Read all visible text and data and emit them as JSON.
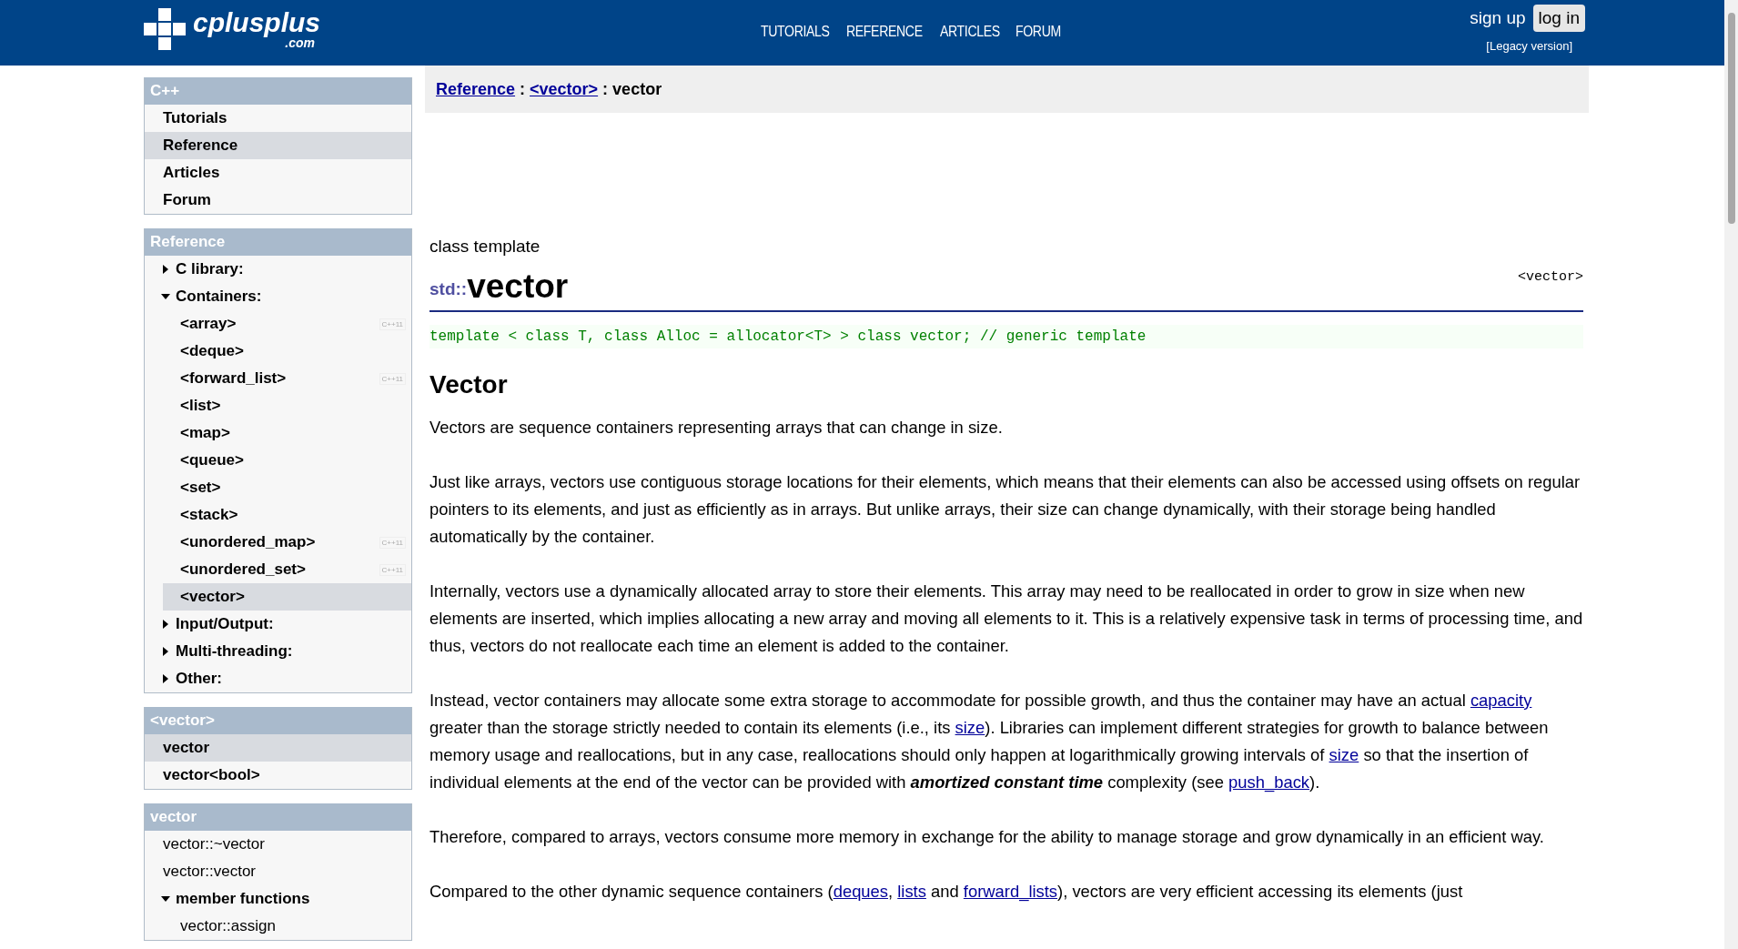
{
  "header": {
    "logo": {
      "name": "cplusplus",
      "suffix": ".com"
    },
    "nav": [
      "TUTORIALS",
      "REFERENCE",
      "ARTICLES",
      "FORUM"
    ],
    "sign_up": "sign up",
    "log_in": "log in",
    "legacy": "[Legacy version]"
  },
  "sidebar": [
    {
      "title": "C++",
      "items": [
        {
          "label": "Tutorials",
          "selected": false
        },
        {
          "label": "Reference",
          "selected": true
        },
        {
          "label": "Articles",
          "selected": false
        },
        {
          "label": "Forum",
          "selected": false
        }
      ]
    },
    {
      "title": "Reference",
      "items": [
        {
          "label": "C library:",
          "selected": false,
          "expanded": false
        },
        {
          "label": "Containers:",
          "selected": false,
          "expanded": true,
          "children": [
            {
              "label": "<array>",
              "selected": false,
              "tag": "C++11"
            },
            {
              "label": "<deque>",
              "selected": false
            },
            {
              "label": "<forward_list>",
              "selected": false,
              "tag": "C++11"
            },
            {
              "label": "<list>",
              "selected": false
            },
            {
              "label": "<map>",
              "selected": false
            },
            {
              "label": "<queue>",
              "selected": false
            },
            {
              "label": "<set>",
              "selected": false
            },
            {
              "label": "<stack>",
              "selected": false
            },
            {
              "label": "<unordered_map>",
              "selected": false,
              "tag": "C++11"
            },
            {
              "label": "<unordered_set>",
              "selected": false,
              "tag": "C++11"
            },
            {
              "label": "<vector>",
              "selected": true
            }
          ]
        },
        {
          "label": "Input/Output:",
          "selected": false,
          "expanded": false
        },
        {
          "label": "Multi-threading:",
          "selected": false,
          "expanded": false
        },
        {
          "label": "Other:",
          "selected": false,
          "expanded": false
        }
      ]
    },
    {
      "title": "<vector>",
      "items": [
        {
          "label": "vector",
          "selected": true
        },
        {
          "label": "vector<bool>",
          "selected": false
        }
      ]
    },
    {
      "title": "vector",
      "plain": true,
      "items": [
        {
          "label": "vector::~vector",
          "selected": false
        },
        {
          "label": "vector::vector",
          "selected": false
        },
        {
          "label": "member functions",
          "selected": false,
          "expanded": true,
          "children": [
            {
              "label": "vector::assign",
              "selected": false
            }
          ]
        }
      ]
    }
  ],
  "breadcrumb": {
    "links": [
      "Reference",
      "<vector>"
    ],
    "current": "vector",
    "separator": ":"
  },
  "article": {
    "kind_label": "class template",
    "namespace": "std::",
    "title": "vector",
    "header": "<vector>",
    "declaration": "template < class T, class Alloc = allocator<T> > class vector; // generic template",
    "heading": "Vector",
    "paragraphs": [
      [
        {
          "text": "Vectors are sequence containers representing arrays that can change in size."
        }
      ],
      [
        {
          "text": "Just like arrays, vectors use contiguous storage locations for their elements, which means that their elements can also be accessed using offsets on regular pointers to its elements, and just as efficiently as in arrays. But unlike arrays, their size can change dynamically, with their storage being handled automatically by the container."
        }
      ],
      [
        {
          "text": "Internally, vectors use a dynamically allocated array to store their elements. This array may need to be reallocated in order to grow in size when new elements are inserted, which implies allocating a new array and moving all elements to it. This is a relatively expensive task in terms of processing time, and thus, vectors do not reallocate each time an element is added to the container."
        }
      ],
      [
        {
          "text": "Instead, vector containers may allocate some extra storage to accommodate for possible growth, and thus the container may have an actual "
        },
        {
          "text": "capacity",
          "link": true
        },
        {
          "text": " greater than the storage strictly needed to contain its elements (i.e., its "
        },
        {
          "text": "size",
          "link": true
        },
        {
          "text": "). Libraries can implement different strategies for growth to balance between memory usage and reallocations, but in any case, reallocations should only happen at logarithmically growing intervals of "
        },
        {
          "text": "size",
          "link": true
        },
        {
          "text": " so that the insertion of individual elements at the end of the vector can be provided with **amortized constant time** complexity (see "
        },
        {
          "text": "push_back",
          "link": true
        },
        {
          "text": ")."
        }
      ],
      [
        {
          "text": "Therefore, compared to arrays, vectors consume more memory in exchange for the ability to manage storage and grow dynamically in an efficient way."
        }
      ],
      [
        {
          "text": "Compared to the other dynamic sequence containers ("
        },
        {
          "text": "deques",
          "link": true
        },
        {
          "text": ", "
        },
        {
          "text": "lists",
          "link": true
        },
        {
          "text": " and "
        },
        {
          "text": "forward_lists",
          "link": true
        },
        {
          "text": "), vectors are very efficient accessing its elements (just"
        }
      ]
    ]
  }
}
